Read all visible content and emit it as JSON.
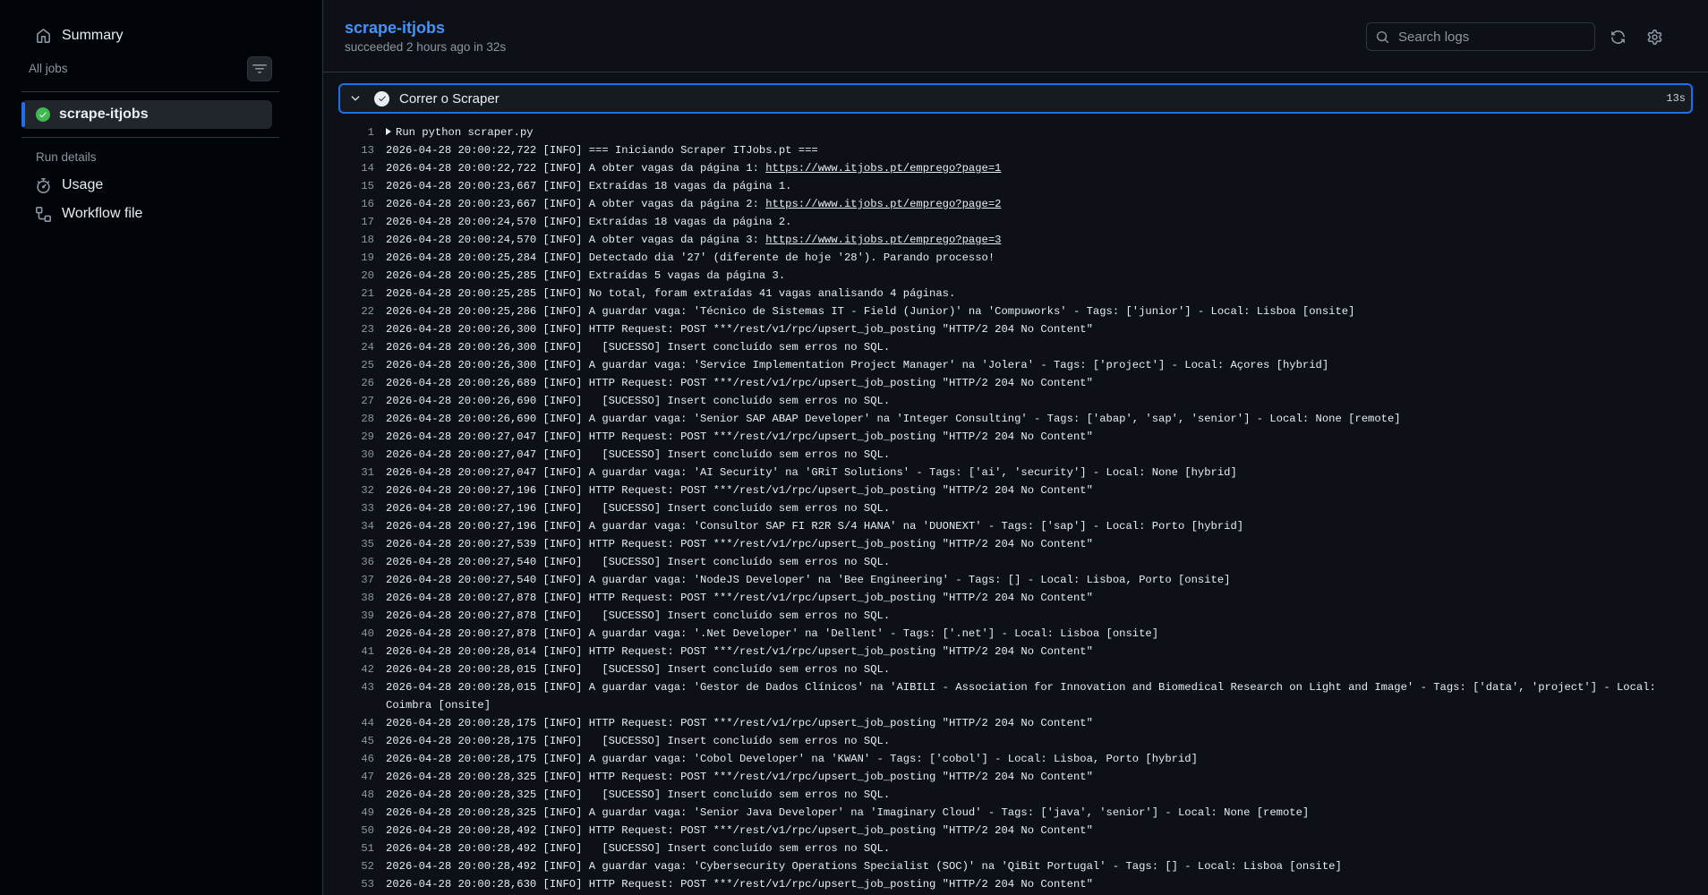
{
  "sidebar": {
    "summary_label": "Summary",
    "all_jobs_label": "All jobs",
    "job_name": "scrape-itjobs",
    "run_details_label": "Run details",
    "usage_label": "Usage",
    "workflow_file_label": "Workflow file"
  },
  "header": {
    "title": "scrape-itjobs",
    "status": "succeeded 2 hours ago in 32s",
    "search_placeholder": "Search logs"
  },
  "step": {
    "name": "Correr o Scraper",
    "duration": "13s"
  },
  "log_lines": [
    {
      "n": "1",
      "text": "Run python scraper.py",
      "collapsed": true
    },
    {
      "n": "13",
      "text": "2026-04-28 20:00:22,722 [INFO] === Iniciando Scraper ITJobs.pt ==="
    },
    {
      "n": "14",
      "text": "2026-04-28 20:00:22,722 [INFO] A obter vagas da página 1: ",
      "link": "https://www.itjobs.pt/emprego?page=1"
    },
    {
      "n": "15",
      "text": "2026-04-28 20:00:23,667 [INFO] Extraídas 18 vagas da página 1."
    },
    {
      "n": "16",
      "text": "2026-04-28 20:00:23,667 [INFO] A obter vagas da página 2: ",
      "link": "https://www.itjobs.pt/emprego?page=2"
    },
    {
      "n": "17",
      "text": "2026-04-28 20:00:24,570 [INFO] Extraídas 18 vagas da página 2."
    },
    {
      "n": "18",
      "text": "2026-04-28 20:00:24,570 [INFO] A obter vagas da página 3: ",
      "link": "https://www.itjobs.pt/emprego?page=3"
    },
    {
      "n": "19",
      "text": "2026-04-28 20:00:25,284 [INFO] Detectado dia '27' (diferente de hoje '28'). Parando processo!"
    },
    {
      "n": "20",
      "text": "2026-04-28 20:00:25,285 [INFO] Extraídas 5 vagas da página 3."
    },
    {
      "n": "21",
      "text": "2026-04-28 20:00:25,285 [INFO] No total, foram extraídas 41 vagas analisando 4 páginas."
    },
    {
      "n": "22",
      "text": "2026-04-28 20:00:25,286 [INFO] A guardar vaga: 'Técnico de Sistemas IT - Field (Junior)' na 'Compuworks' - Tags: ['junior'] - Local: Lisboa [onsite]"
    },
    {
      "n": "23",
      "text": "2026-04-28 20:00:26,300 [INFO] HTTP Request: POST ***/rest/v1/rpc/upsert_job_posting \"HTTP/2 204 No Content\""
    },
    {
      "n": "24",
      "text": "2026-04-28 20:00:26,300 [INFO]   [SUCESSO] Insert concluído sem erros no SQL."
    },
    {
      "n": "25",
      "text": "2026-04-28 20:00:26,300 [INFO] A guardar vaga: 'Service Implementation Project Manager' na 'Jolera' - Tags: ['project'] - Local: Açores [hybrid]"
    },
    {
      "n": "26",
      "text": "2026-04-28 20:00:26,689 [INFO] HTTP Request: POST ***/rest/v1/rpc/upsert_job_posting \"HTTP/2 204 No Content\""
    },
    {
      "n": "27",
      "text": "2026-04-28 20:00:26,690 [INFO]   [SUCESSO] Insert concluído sem erros no SQL."
    },
    {
      "n": "28",
      "text": "2026-04-28 20:00:26,690 [INFO] A guardar vaga: 'Senior SAP ABAP Developer' na 'Integer Consulting' - Tags: ['abap', 'sap', 'senior'] - Local: None [remote]"
    },
    {
      "n": "29",
      "text": "2026-04-28 20:00:27,047 [INFO] HTTP Request: POST ***/rest/v1/rpc/upsert_job_posting \"HTTP/2 204 No Content\""
    },
    {
      "n": "30",
      "text": "2026-04-28 20:00:27,047 [INFO]   [SUCESSO] Insert concluído sem erros no SQL."
    },
    {
      "n": "31",
      "text": "2026-04-28 20:00:27,047 [INFO] A guardar vaga: 'AI Security' na 'GRiT Solutions' - Tags: ['ai', 'security'] - Local: None [hybrid]"
    },
    {
      "n": "32",
      "text": "2026-04-28 20:00:27,196 [INFO] HTTP Request: POST ***/rest/v1/rpc/upsert_job_posting \"HTTP/2 204 No Content\""
    },
    {
      "n": "33",
      "text": "2026-04-28 20:00:27,196 [INFO]   [SUCESSO] Insert concluído sem erros no SQL."
    },
    {
      "n": "34",
      "text": "2026-04-28 20:00:27,196 [INFO] A guardar vaga: 'Consultor SAP FI R2R S/4 HANA' na 'DUONEXT' - Tags: ['sap'] - Local: Porto [hybrid]"
    },
    {
      "n": "35",
      "text": "2026-04-28 20:00:27,539 [INFO] HTTP Request: POST ***/rest/v1/rpc/upsert_job_posting \"HTTP/2 204 No Content\""
    },
    {
      "n": "36",
      "text": "2026-04-28 20:00:27,540 [INFO]   [SUCESSO] Insert concluído sem erros no SQL."
    },
    {
      "n": "37",
      "text": "2026-04-28 20:00:27,540 [INFO] A guardar vaga: 'NodeJS Developer' na 'Bee Engineering' - Tags: [] - Local: Lisboa, Porto [onsite]"
    },
    {
      "n": "38",
      "text": "2026-04-28 20:00:27,878 [INFO] HTTP Request: POST ***/rest/v1/rpc/upsert_job_posting \"HTTP/2 204 No Content\""
    },
    {
      "n": "39",
      "text": "2026-04-28 20:00:27,878 [INFO]   [SUCESSO] Insert concluído sem erros no SQL."
    },
    {
      "n": "40",
      "text": "2026-04-28 20:00:27,878 [INFO] A guardar vaga: '.Net Developer' na 'Dellent' - Tags: ['.net'] - Local: Lisboa [onsite]"
    },
    {
      "n": "41",
      "text": "2026-04-28 20:00:28,014 [INFO] HTTP Request: POST ***/rest/v1/rpc/upsert_job_posting \"HTTP/2 204 No Content\""
    },
    {
      "n": "42",
      "text": "2026-04-28 20:00:28,015 [INFO]   [SUCESSO] Insert concluído sem erros no SQL."
    },
    {
      "n": "43",
      "text": "2026-04-28 20:00:28,015 [INFO] A guardar vaga: 'Gestor de Dados Clínicos' na 'AIBILI - Association for Innovation and Biomedical Research on Light and Image' - Tags: ['data', 'project'] - Local: Coimbra [onsite]"
    },
    {
      "n": "44",
      "text": "2026-04-28 20:00:28,175 [INFO] HTTP Request: POST ***/rest/v1/rpc/upsert_job_posting \"HTTP/2 204 No Content\""
    },
    {
      "n": "45",
      "text": "2026-04-28 20:00:28,175 [INFO]   [SUCESSO] Insert concluído sem erros no SQL."
    },
    {
      "n": "46",
      "text": "2026-04-28 20:00:28,175 [INFO] A guardar vaga: 'Cobol Developer' na 'KWAN' - Tags: ['cobol'] - Local: Lisboa, Porto [hybrid]"
    },
    {
      "n": "47",
      "text": "2026-04-28 20:00:28,325 [INFO] HTTP Request: POST ***/rest/v1/rpc/upsert_job_posting \"HTTP/2 204 No Content\""
    },
    {
      "n": "48",
      "text": "2026-04-28 20:00:28,325 [INFO]   [SUCESSO] Insert concluído sem erros no SQL."
    },
    {
      "n": "49",
      "text": "2026-04-28 20:00:28,325 [INFO] A guardar vaga: 'Senior Java Developer' na 'Imaginary Cloud' - Tags: ['java', 'senior'] - Local: None [remote]"
    },
    {
      "n": "50",
      "text": "2026-04-28 20:00:28,492 [INFO] HTTP Request: POST ***/rest/v1/rpc/upsert_job_posting \"HTTP/2 204 No Content\""
    },
    {
      "n": "51",
      "text": "2026-04-28 20:00:28,492 [INFO]   [SUCESSO] Insert concluído sem erros no SQL."
    },
    {
      "n": "52",
      "text": "2026-04-28 20:00:28,492 [INFO] A guardar vaga: 'Cybersecurity Operations Specialist (SOC)' na 'QiBit Portugal' - Tags: [] - Local: Lisboa [onsite]"
    },
    {
      "n": "53",
      "text": "2026-04-28 20:00:28,630 [INFO] HTTP Request: POST ***/rest/v1/rpc/upsert_job_posting \"HTTP/2 204 No Content\""
    }
  ]
}
